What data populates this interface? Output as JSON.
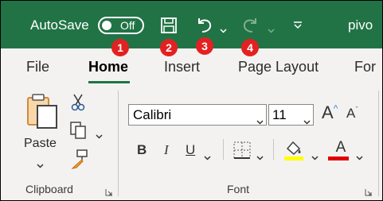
{
  "titlebar": {
    "autosave_label": "AutoSave",
    "autosave_state": "Off",
    "filename_partial": "pivo",
    "accent": "#217346"
  },
  "badges": [
    "1",
    "2",
    "3",
    "4"
  ],
  "tabs": [
    {
      "label": "File",
      "active": false
    },
    {
      "label": "Home",
      "active": true
    },
    {
      "label": "Insert",
      "active": false
    },
    {
      "label": "Page Layout",
      "active": false
    },
    {
      "label": "For",
      "active": false
    }
  ],
  "clipboard": {
    "paste_label": "Paste",
    "group_label": "Clipboard"
  },
  "font": {
    "family": "Calibri",
    "size": "11",
    "bold": "B",
    "italic": "I",
    "underline": "U",
    "font_color_letter": "A",
    "group_label": "Font",
    "highlight_color": "#ffff00",
    "font_color": "#e00000"
  },
  "icons": [
    "save-icon",
    "undo-icon",
    "redo-icon",
    "customize-qat-icon",
    "clipboard-icon",
    "cut-icon",
    "copy-icon",
    "format-painter-icon",
    "borders-icon",
    "fill-color-icon",
    "dialog-launcher-icon"
  ]
}
